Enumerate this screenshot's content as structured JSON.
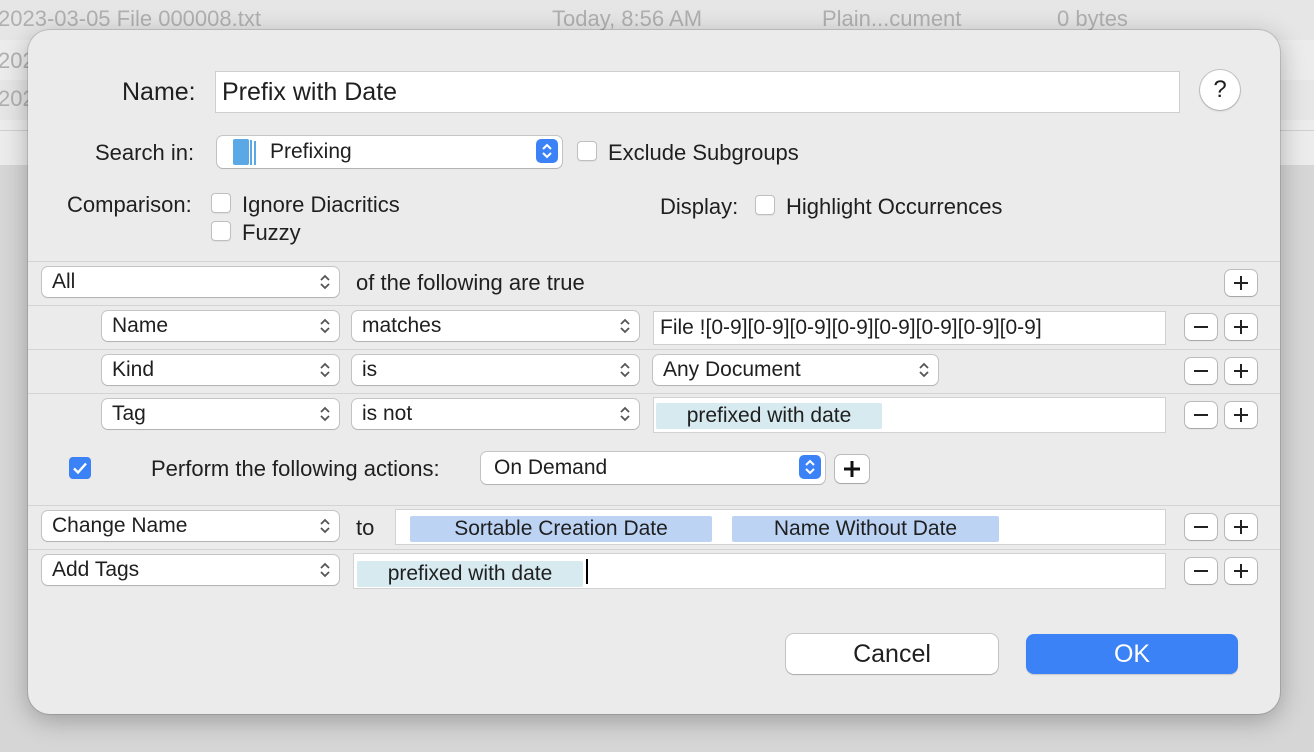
{
  "background": {
    "rows": [
      {
        "name": "2023-03-05 File 000008.txt",
        "date": "Today, 8:56 AM",
        "kind": "Plain...cument",
        "size": "0 bytes"
      },
      {
        "name": "202",
        "date": "",
        "kind": "",
        "size": ""
      },
      {
        "name": "202",
        "date": "",
        "kind": "",
        "size": ""
      }
    ]
  },
  "dialog": {
    "name_label": "Name:",
    "name_value": "Prefix with Date",
    "help_label": "?",
    "search_in_label": "Search in:",
    "search_in_value": "Prefixing",
    "exclude_subgroups_label": "Exclude Subgroups",
    "comparison_label": "Comparison:",
    "ignore_diacritics_label": "Ignore Diacritics",
    "fuzzy_label": "Fuzzy",
    "display_label": "Display:",
    "highlight_label": "Highlight Occurrences",
    "match_mode": "All",
    "match_suffix": "of the following are true",
    "criteria": [
      {
        "field": "Name",
        "operator": "matches",
        "value": "File ![0-9][0-9][0-9][0-9][0-9][0-9][0-9][0-9]"
      },
      {
        "field": "Kind",
        "operator": "is",
        "value": "Any Document"
      },
      {
        "field": "Tag",
        "operator": "is not",
        "value": "prefixed with date"
      }
    ],
    "perform_label": "Perform the following actions:",
    "perform_checked": true,
    "perform_when": "On Demand",
    "actions": [
      {
        "action": "Change Name",
        "to_label": "to",
        "tokens": [
          "Sortable Creation Date",
          "Name Without Date"
        ]
      },
      {
        "action": "Add Tags",
        "tokens": [
          "prefixed with date"
        ]
      }
    ],
    "cancel_label": "Cancel",
    "ok_label": "OK"
  },
  "colors": {
    "accent": "#3b82f6",
    "token_var": "#bcd3f4",
    "token_tag": "#d6eaf0"
  }
}
